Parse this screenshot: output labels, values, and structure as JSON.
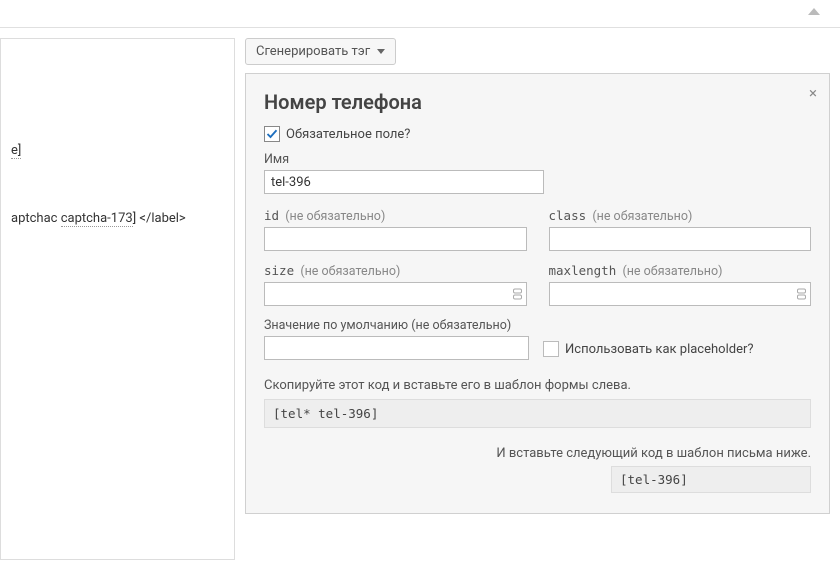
{
  "editor": {
    "line1_suffix": "e]",
    "line2_prefix": "aptchac ",
    "line2_tag": "captcha-173",
    "line2_suffix": "] </label>"
  },
  "generate_button": "Сгенерировать тэг",
  "panel": {
    "title": "Номер телефона",
    "required_label": "Обязательное поле?",
    "name_label": "Имя",
    "name_value": "tel-396",
    "id_label": "id",
    "class_label": "class",
    "size_label": "size",
    "maxlength_label": "maxlength",
    "optional_hint": "(не обязательно)",
    "default_label": "Значение по умолчанию (не обязательно)",
    "placeholder_checkbox": "Использовать как placeholder?",
    "copy_text": "Скопируйте этот код и вставьте его в шаблон формы слева.",
    "form_code": "[tel* tel-396]",
    "mail_text": "И вставьте следующий код в шаблон письма ниже.",
    "mail_code": "[tel-396]"
  }
}
